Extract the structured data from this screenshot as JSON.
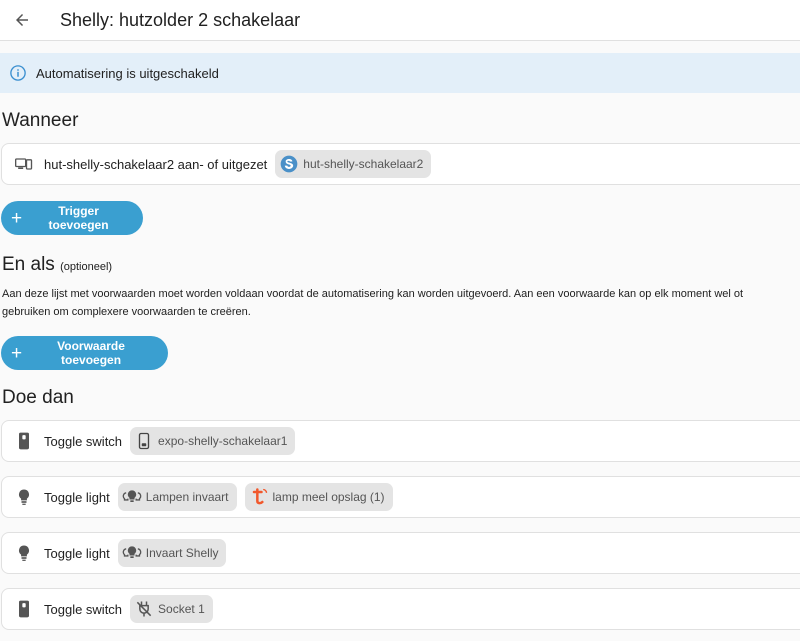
{
  "header": {
    "title": "Shelly: hutzolder 2 schakelaar"
  },
  "banner": {
    "text": "Automatisering is uitgeschakeld"
  },
  "when": {
    "title": "Wanneer",
    "triggers": [
      {
        "label": "hut-shelly-schakelaar2 aan- of uitgezet",
        "chip": "hut-shelly-schakelaar2"
      }
    ],
    "add_label": "Trigger toevoegen"
  },
  "and_if": {
    "title": "En als",
    "optional": "(optioneel)",
    "description_line1": "Aan deze lijst met voorwaarden moet worden voldaan voordat de automatisering kan worden uitgevoerd. Aan een voorwaarde kan op elk moment wel ot",
    "description_line2": "gebruiken om complexere voorwaarden te creëren.",
    "add_label": "Voorwaarde toevoegen"
  },
  "then": {
    "title": "Doe dan",
    "actions": [
      {
        "label": "Toggle switch",
        "chips": [
          "expo-shelly-schakelaar1"
        ]
      },
      {
        "label": "Toggle light",
        "chips": [
          "Lampen invaart",
          "lamp meel opslag (1)"
        ]
      },
      {
        "label": "Toggle light",
        "chips": [
          "Invaart Shelly"
        ]
      },
      {
        "label": "Toggle switch",
        "chips": [
          "Socket 1"
        ]
      }
    ]
  },
  "colors": {
    "accent": "#3a9fd0",
    "banner_bg": "#e3eff9",
    "tuya_orange": "#f1582c",
    "shelly_blue": "#4a90c8"
  }
}
